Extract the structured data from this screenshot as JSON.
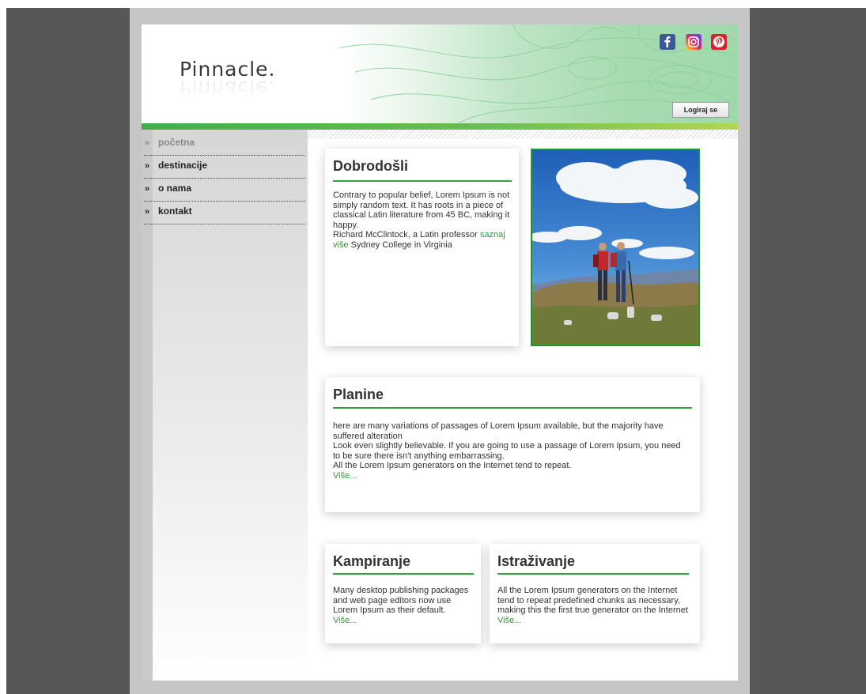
{
  "site": {
    "logo": "Pinnacle."
  },
  "header": {
    "login_label": "Logiraj se",
    "social": [
      "facebook-icon",
      "instagram-icon",
      "pinterest-icon"
    ]
  },
  "nav": {
    "items": [
      {
        "label": "početna",
        "active": true
      },
      {
        "label": "destinacije",
        "active": false
      },
      {
        "label": "o nama",
        "active": false
      },
      {
        "label": "kontakt",
        "active": false
      }
    ],
    "arrow": "»"
  },
  "welcome": {
    "title": "Dobrodošli",
    "text1": "Contrary to popular belief, Lorem Ipsum is not simply random text. It has roots in a piece of classical Latin literature from 45 BC, making it happy.",
    "text2a": "Richard McClintock, a Latin professor ",
    "link": "saznaj više",
    "text2b": " Sydney College in Virginia"
  },
  "planine": {
    "title": "Planine",
    "lines": [
      "here are many variations of passages of Lorem Ipsum available, but the majority have suffered alteration",
      "Look even slightly believable. If you are going to use a passage of Lorem Ipsum, you need to be sure there isn't anything embarrassing.",
      "All the Lorem Ipsum generators on the Internet tend to repeat."
    ],
    "more": "Više..."
  },
  "kampiranje": {
    "title": "Kampiranje",
    "text": "Many desktop publishing packages and web page editors now use Lorem Ipsum as their default.",
    "more": "Više..."
  },
  "istrazivanje": {
    "title": "Istraživanje",
    "text": "All the Lorem Ipsum generators on the Internet tend to repeat predefined chunks as necessary, making this the first true generator on the Internet",
    "more": "Više..."
  },
  "colors": {
    "accent": "#2fa43a",
    "background": "#575757",
    "frame": "#c6c6c6"
  }
}
